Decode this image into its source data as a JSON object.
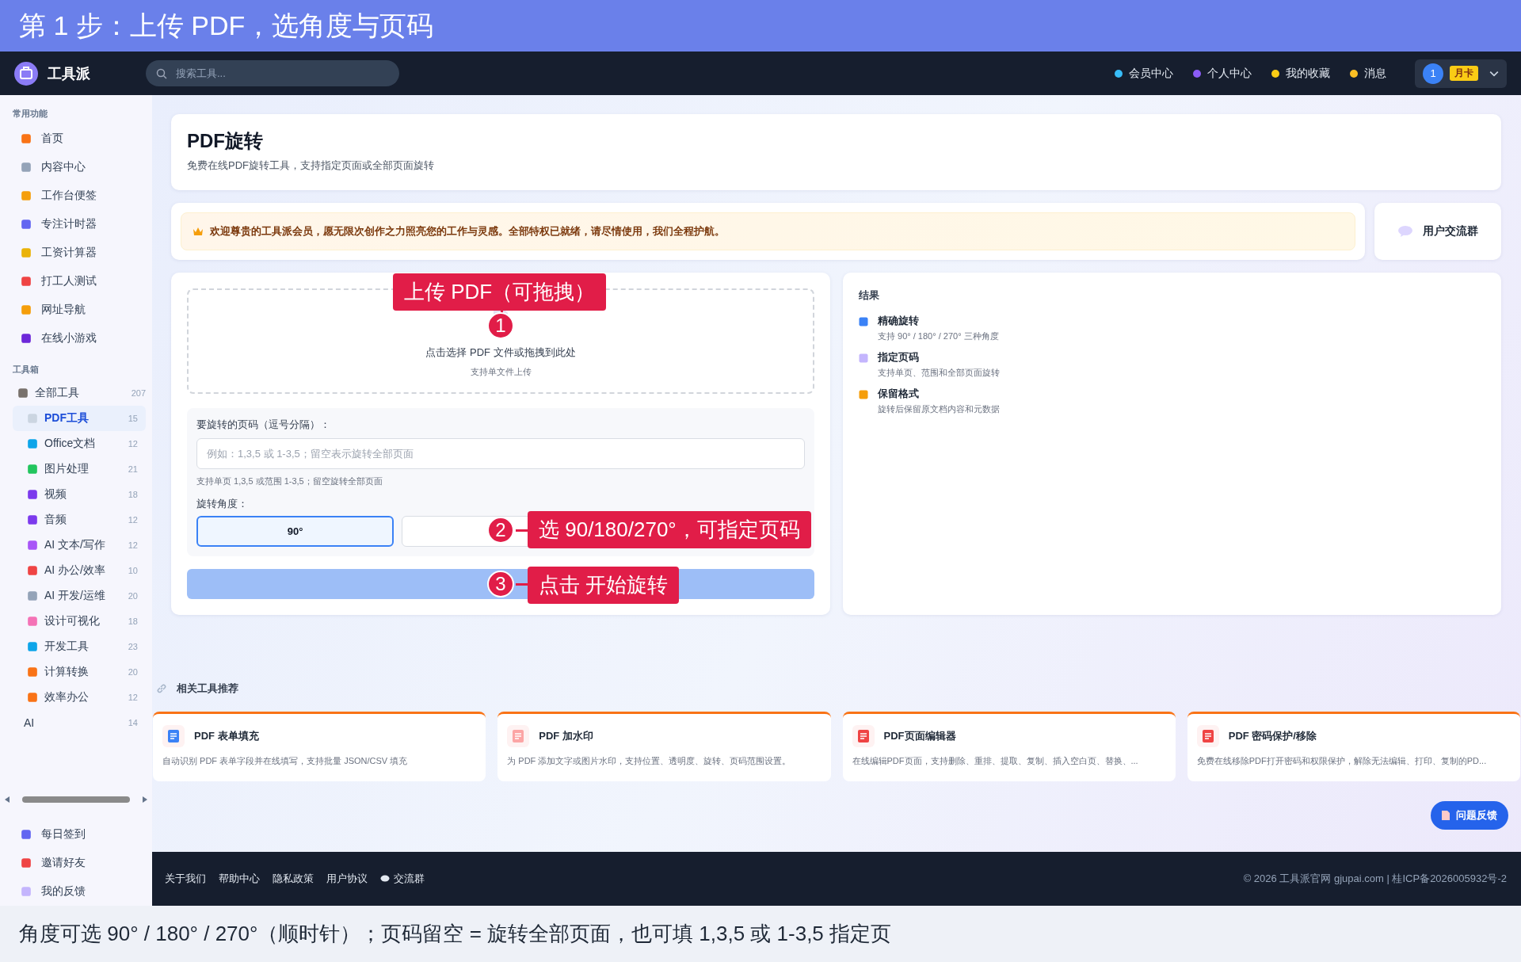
{
  "banner": {
    "title": "第 1 步：上传 PDF，选角度与页码"
  },
  "nav": {
    "brand": "工具派",
    "search_placeholder": "搜索工具...",
    "links": [
      {
        "label": "会员中心"
      },
      {
        "label": "个人中心"
      },
      {
        "label": "我的收藏"
      },
      {
        "label": "消息"
      }
    ],
    "user": {
      "avatar": "1",
      "badge": "月卡"
    }
  },
  "sidebar": {
    "sections": [
      {
        "title": "常用功能",
        "items": [
          {
            "label": "首页",
            "kind": "link"
          },
          {
            "label": "内容中心",
            "kind": "link"
          },
          {
            "label": "工作台便签",
            "kind": "link"
          },
          {
            "label": "专注计时器",
            "kind": "link"
          },
          {
            "label": "工资计算器",
            "kind": "link"
          },
          {
            "label": "打工人测试",
            "kind": "link"
          },
          {
            "label": "网址导航",
            "kind": "link"
          },
          {
            "label": "在线小游戏",
            "kind": "link"
          }
        ]
      },
      {
        "title": "工具箱",
        "items": [
          {
            "label": "全部工具",
            "count": "207",
            "kind": "parent",
            "selected": false
          },
          {
            "label": "PDF工具",
            "count": "15",
            "kind": "category",
            "selected": true
          },
          {
            "label": "Office文档",
            "count": "12",
            "kind": "category",
            "selected": false
          },
          {
            "label": "图片处理",
            "count": "21",
            "kind": "category",
            "selected": false
          },
          {
            "label": "视频",
            "count": "18",
            "kind": "category",
            "selected": false
          },
          {
            "label": "音频",
            "count": "12",
            "kind": "category",
            "selected": false
          },
          {
            "label": "AI 文本/写作",
            "count": "12",
            "kind": "category",
            "selected": false
          },
          {
            "label": "AI 办公/效率",
            "count": "10",
            "kind": "category",
            "selected": false
          },
          {
            "label": "AI 开发/运维",
            "count": "20",
            "kind": "category",
            "selected": false
          },
          {
            "label": "设计可视化",
            "count": "18",
            "kind": "category",
            "selected": false
          },
          {
            "label": "开发工具",
            "count": "23",
            "kind": "category",
            "selected": false
          },
          {
            "label": "计算转换",
            "count": "20",
            "kind": "category",
            "selected": false
          },
          {
            "label": "效率办公",
            "count": "12",
            "kind": "category",
            "selected": false
          },
          {
            "label": "AI",
            "count": "14",
            "kind": "plain",
            "selected": false
          }
        ]
      }
    ],
    "bottom_items": [
      {
        "label": "每日签到"
      },
      {
        "label": "邀请好友"
      },
      {
        "label": "我的反馈"
      }
    ]
  },
  "header": {
    "title": "PDF旋转",
    "subtitle": "免费在线PDF旋转工具，支持指定页面或全部页面旋转"
  },
  "welcome": {
    "message": "欢迎尊贵的工具派会员，愿无限次创作之力照亮您的工作与灵感。全部特权已就绪，请尽情使用，我们全程护航。",
    "community": "用户交流群"
  },
  "upload": {
    "prompt": "点击选择 PDF 文件或拖拽到此处",
    "hint": "支持单文件上传"
  },
  "form": {
    "pages_label": "要旋转的页码（逗号分隔）：",
    "pages_placeholder": "例如：1,3,5 或 1-3,5；留空表示旋转全部页面",
    "pages_hint": "支持单页 1,3,5 或范围 1-3,5；留空旋转全部页面",
    "angle_label": "旋转角度：",
    "angles": [
      {
        "label": "90°",
        "selected": true
      },
      {
        "selected": false
      }
    ]
  },
  "annotations": [
    {
      "number": "1",
      "text": "上传 PDF（可拖拽）"
    },
    {
      "number": "2",
      "text": "选 90/180/270°，可指定页码"
    },
    {
      "number": "3",
      "text": "点击 开始旋转"
    }
  ],
  "results": {
    "title": "结果",
    "features": [
      {
        "title": "精确旋转",
        "desc": "支持 90° / 180° / 270° 三种角度"
      },
      {
        "title": "指定页码",
        "desc": "支持单页、范围和全部页面旋转"
      },
      {
        "title": "保留格式",
        "desc": "旋转后保留原文档内容和元数据"
      }
    ]
  },
  "related": {
    "title": "相关工具推荐",
    "tools": [
      {
        "title": "PDF 表单填充",
        "desc": "自动识别 PDF 表单字段并在线填写，支持批量 JSON/CSV 填充"
      },
      {
        "title": "PDF 加水印",
        "desc": "为 PDF 添加文字或图片水印，支持位置、透明度、旋转、页码范围设置。"
      },
      {
        "title": "PDF页面编辑器",
        "desc": "在线编辑PDF页面，支持删除、重排、提取、复制、插入空白页、替换、..."
      },
      {
        "title": "PDF 密码保护/移除",
        "desc": "免费在线移除PDF打开密码和权限保护，解除无法编辑、打印、复制的PD..."
      }
    ]
  },
  "feedback": "问题反馈",
  "footer": {
    "links": [
      {
        "label": "关于我们",
        "kind": "text"
      },
      {
        "label": "帮助中心",
        "kind": "text"
      },
      {
        "label": "隐私政策",
        "kind": "text"
      },
      {
        "label": "用户协议",
        "kind": "text"
      },
      {
        "label": "交流群",
        "kind": "chat"
      }
    ],
    "copyright": "© 2026 工具派官网 gjupai.com | 桂ICP备2026005932号-2"
  },
  "caption": "角度可选 90° / 180° / 270°（顺时针）；页码留空 = 旋转全部页面，也可填 1,3,5 或 1-3,5 指定页"
}
